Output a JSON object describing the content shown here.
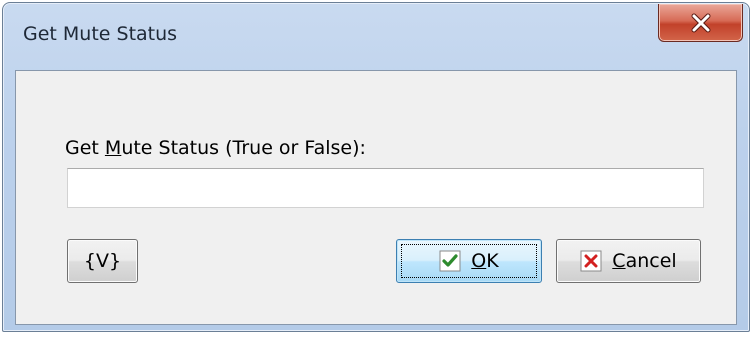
{
  "window": {
    "title": "Get Mute Status",
    "close_icon": "close-icon"
  },
  "form": {
    "label_before": "Get ",
    "label_mnemonic": "M",
    "label_after": "ute Status (True or False):",
    "value": ""
  },
  "buttons": {
    "variables_label": "{V}",
    "ok_label": "OK",
    "ok_icon": "checkmark-icon",
    "cancel_label": "Cancel",
    "cancel_icon": "x-icon"
  },
  "colors": {
    "close_button": "#c2412a",
    "ok_check": "#2e8b2e",
    "cancel_x": "#d32020",
    "titlebar": "#bcd1ec"
  }
}
